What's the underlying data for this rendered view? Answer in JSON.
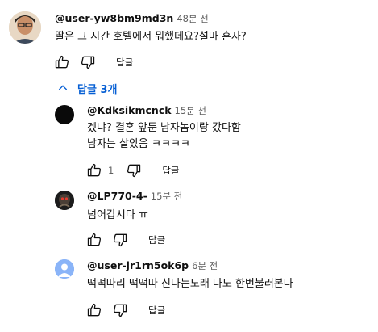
{
  "top_comment": {
    "author": "@user-yw8bm9md3n",
    "time": "48분 전",
    "text": "딸은 그 시간 호텔에서 뭐했데요?설마 혼자?",
    "reply_label": "답글"
  },
  "replies_toggle": {
    "label": "답글 3개",
    "icon": "chevron-up-icon"
  },
  "replies": [
    {
      "author": "@Kdksikmcnck",
      "time": "15분 전",
      "text": "겠냐? 결혼 앞둔 남자놈이랑 갔다함\n남자는 살았음 ㅋㅋㅋㅋ",
      "likes": "1",
      "reply_label": "답글"
    },
    {
      "author": "@LP770-4-",
      "time": "15분 전",
      "text": "넘어갑시다 ㅠ",
      "reply_label": "답글"
    },
    {
      "author": "@user-jr1rn5ok6p",
      "time": "6분 전",
      "text": "떡떡따리 떡떡따 신나는노래 나도 한번불러본다",
      "reply_label": "답글"
    }
  ],
  "colors": {
    "link_blue": "#065fd4",
    "secondary_text": "#606060",
    "avatar_blue": "#8ab4f8"
  }
}
